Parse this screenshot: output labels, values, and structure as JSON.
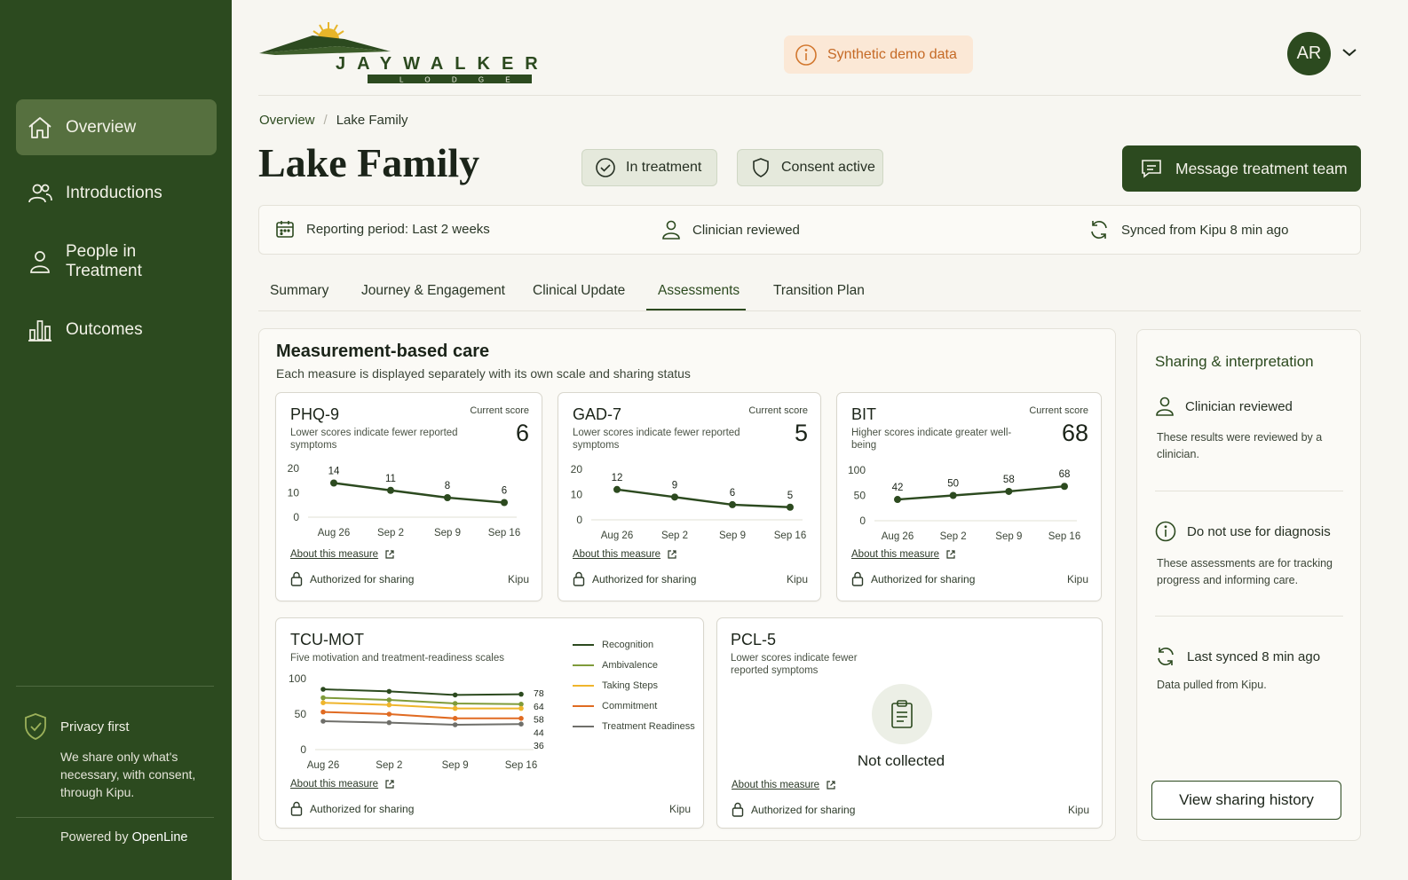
{
  "sidebar": {
    "items": [
      {
        "label": "Overview",
        "icon": "home-icon",
        "active": true
      },
      {
        "label": "Introductions",
        "icon": "people-icon",
        "active": false
      },
      {
        "label": "People in Treatment",
        "icon": "person-icon",
        "active": false
      },
      {
        "label": "Outcomes",
        "icon": "bar-chart-icon",
        "active": false
      }
    ],
    "privacy_title": "Privacy first",
    "privacy_text": "We share only what's necessary, with consent, through Kipu.",
    "powered_prefix": "Powered by",
    "powered_brand": "OpenLine"
  },
  "header": {
    "logo_text": "JAYWALKER",
    "logo_subtext": "L O D G E",
    "demo_badge": "Synthetic demo data",
    "avatar_initials": "AR"
  },
  "breadcrumb": [
    "Overview",
    "Lake Family"
  ],
  "page_title": "Lake Family",
  "status_pills": [
    "In treatment",
    "Consent active"
  ],
  "message_button": "Message treatment team",
  "info_bar": {
    "reporting_period": "Reporting period: Last 2 weeks",
    "review_status": "Clinician reviewed",
    "sync_status": "Synced from Kipu 8 min ago"
  },
  "tabs": [
    "Summary",
    "Journey & Engagement",
    "Clinical Update",
    "Assessments",
    "Transition Plan"
  ],
  "active_tab": "Assessments",
  "mbc": {
    "title": "Measurement-based care",
    "subtitle": "Each measure is displayed separately with its own scale and sharing status"
  },
  "common": {
    "current_score_label": "Current score",
    "about_label": "About this measure",
    "auth_label": "Authorized for sharing",
    "source_label": "Kipu"
  },
  "cards": {
    "phq9": {
      "name": "PHQ-9",
      "description": "Lower scores indicate fewer reported symptoms",
      "current_score": "6"
    },
    "gad7": {
      "name": "GAD-7",
      "description": "Lower scores indicate fewer reported symptoms",
      "current_score": "5"
    },
    "bit": {
      "name": "BIT",
      "description": "Higher scores indicate greater well-being",
      "current_score": "68"
    },
    "tcumot": {
      "name": "TCU-MOT",
      "description": "Five motivation and treatment-readiness scales"
    },
    "pcl5": {
      "name": "PCL-5",
      "description": "Lower scores indicate fewer reported symptoms",
      "status": "Not collected"
    }
  },
  "chart_data": [
    {
      "id": "phq9",
      "type": "line",
      "x": [
        "Aug 26",
        "Sep 2",
        "Sep 9",
        "Sep 16"
      ],
      "series": [
        {
          "values": [
            14,
            11,
            8,
            6
          ],
          "color": "#2c4a1f"
        }
      ],
      "yticks": [
        0,
        10,
        20
      ],
      "ylim": [
        0,
        20
      ],
      "data_labels": true
    },
    {
      "id": "gad7",
      "type": "line",
      "x": [
        "Aug 26",
        "Sep 2",
        "Sep 9",
        "Sep 16"
      ],
      "series": [
        {
          "values": [
            12,
            9,
            6,
            5
          ],
          "color": "#2c4a1f"
        }
      ],
      "yticks": [
        0,
        10,
        20
      ],
      "ylim": [
        0,
        20
      ],
      "data_labels": true
    },
    {
      "id": "bit",
      "type": "line",
      "x": [
        "Aug 26",
        "Sep 2",
        "Sep 9",
        "Sep 16"
      ],
      "series": [
        {
          "values": [
            42,
            50,
            58,
            68
          ],
          "color": "#2c4a1f"
        }
      ],
      "yticks": [
        0,
        50,
        100
      ],
      "ylim": [
        0,
        100
      ],
      "data_labels": true
    },
    {
      "id": "tcumot",
      "type": "line",
      "x": [
        "Aug 26",
        "Sep 2",
        "Sep 9",
        "Sep 16"
      ],
      "yticks": [
        0,
        50,
        100
      ],
      "ylim": [
        0,
        100
      ],
      "end_labels": true,
      "series": [
        {
          "name": "Recognition",
          "values": [
            85,
            82,
            77,
            78
          ],
          "color": "#2c4a1f"
        },
        {
          "name": "Ambivalence",
          "values": [
            73,
            70,
            65,
            64
          ],
          "color": "#7f9b3a"
        },
        {
          "name": "Taking Steps",
          "values": [
            66,
            63,
            58,
            58
          ],
          "color": "#efb52c"
        },
        {
          "name": "Commitment",
          "values": [
            53,
            50,
            44,
            44
          ],
          "color": "#e06b22"
        },
        {
          "name": "Treatment Readiness",
          "values": [
            40,
            38,
            35,
            36
          ],
          "color": "#6f6f6a"
        }
      ]
    }
  ],
  "side_panel": {
    "title": "Sharing & interpretation",
    "sections": [
      {
        "heading": "Clinician reviewed",
        "text": "These results were reviewed by a clinician."
      },
      {
        "heading": "Do not use for diagnosis",
        "text": "These assessments are for tracking progress and informing care."
      },
      {
        "heading": "Last synced 8 min ago",
        "text": "Data pulled from Kipu."
      }
    ],
    "history_button": "View sharing history"
  },
  "colors": {
    "brand": "#2c4a1f",
    "accent_light": "#56703f",
    "badge_warning_bg": "#fbe8d6",
    "badge_warning_text": "#c56a26"
  }
}
